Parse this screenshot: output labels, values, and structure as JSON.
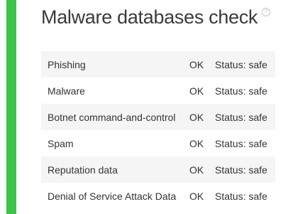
{
  "page": {
    "title": "Malware databases check",
    "help_icon": "question-mark-circle-icon",
    "accent_color": "#3cc34a"
  },
  "databases": [
    {
      "name": "Phishing",
      "result": "OK",
      "status": "Status: safe"
    },
    {
      "name": "Malware",
      "result": "OK",
      "status": "Status: safe"
    },
    {
      "name": "Botnet command-and-control",
      "result": "OK",
      "status": "Status: safe"
    },
    {
      "name": "Spam",
      "result": "OK",
      "status": "Status: safe"
    },
    {
      "name": "Reputation data",
      "result": "OK",
      "status": "Status: safe"
    },
    {
      "name": "Denial of Service Attack Data",
      "result": "OK",
      "status": "Status: safe"
    }
  ]
}
